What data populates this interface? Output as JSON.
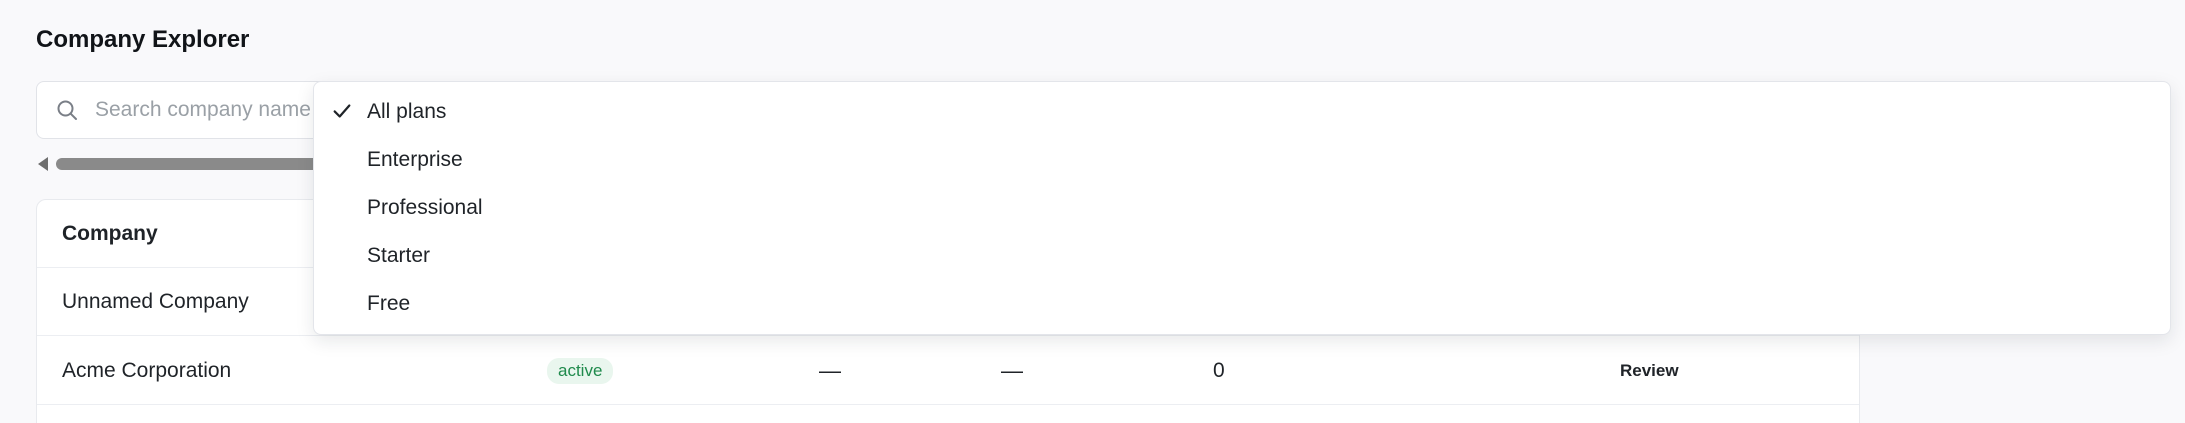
{
  "page": {
    "title": "Company Explorer"
  },
  "search": {
    "placeholder": "Search company name",
    "value": ""
  },
  "table": {
    "headers": {
      "company": "Company"
    },
    "rows": [
      {
        "company": "Unnamed Company"
      },
      {
        "company": "Acme Corporation",
        "status": "active",
        "col3": "—",
        "col4": "—",
        "count": "0",
        "action": "Review"
      }
    ]
  },
  "plan_filter": {
    "selected": "All plans",
    "options": [
      "All plans",
      "Enterprise",
      "Professional",
      "Starter",
      "Free"
    ]
  },
  "colors": {
    "status_active_bg": "#e9f6ee",
    "status_active_text": "#1f8a4c",
    "background": "#f9f9fb"
  },
  "icons": {
    "search": "search-icon",
    "check": "check-icon",
    "scroll_left": "scroll-left-arrow-icon"
  }
}
